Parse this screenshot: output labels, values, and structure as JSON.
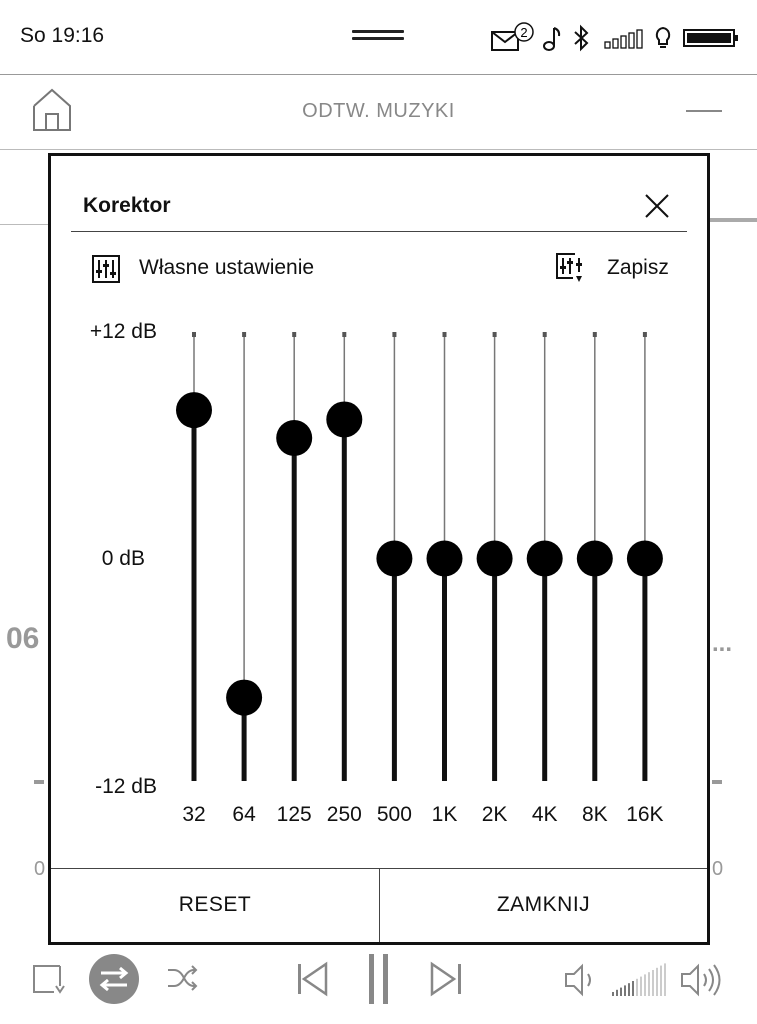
{
  "status_bar": {
    "time": "So 19:16",
    "mail_count": "2",
    "icons": [
      "mail-icon",
      "music-note-icon",
      "bluetooth-icon",
      "signal-icon",
      "frontlight-icon",
      "battery-icon"
    ]
  },
  "header": {
    "title": "ODTW. MUZYKI",
    "home_icon": "home-icon",
    "menu_icon": "menu-icon"
  },
  "background": {
    "track_number": "06",
    "ellipsis": "...",
    "left_zero": "0",
    "right_zero": "0"
  },
  "dialog": {
    "title": "Korektor",
    "preset_label": "Własne ustawienie",
    "save_label": "Zapisz",
    "reset_label": "RESET",
    "close_label": "ZAMKNIJ",
    "db_labels": {
      "top": "+12 dB",
      "mid": "0 dB",
      "bottom": "-12 dB"
    },
    "equalizer": {
      "range_db": [
        -12,
        12
      ],
      "bands": [
        {
          "freq": "32",
          "gain_db": 8
        },
        {
          "freq": "64",
          "gain_db": -7.5
        },
        {
          "freq": "125",
          "gain_db": 6.5
        },
        {
          "freq": "250",
          "gain_db": 7.5
        },
        {
          "freq": "500",
          "gain_db": 0
        },
        {
          "freq": "1K",
          "gain_db": 0
        },
        {
          "freq": "2K",
          "gain_db": 0
        },
        {
          "freq": "4K",
          "gain_db": 0
        },
        {
          "freq": "8K",
          "gain_db": 0
        },
        {
          "freq": "16K",
          "gain_db": 0
        }
      ]
    }
  },
  "player": {
    "icons": [
      "playlist-icon",
      "repeat-icon",
      "shuffle-icon",
      "previous-icon",
      "pause-icon",
      "next-icon",
      "volume-down-icon",
      "volume-level-icon",
      "volume-up-icon"
    ],
    "accent": "#888888"
  }
}
